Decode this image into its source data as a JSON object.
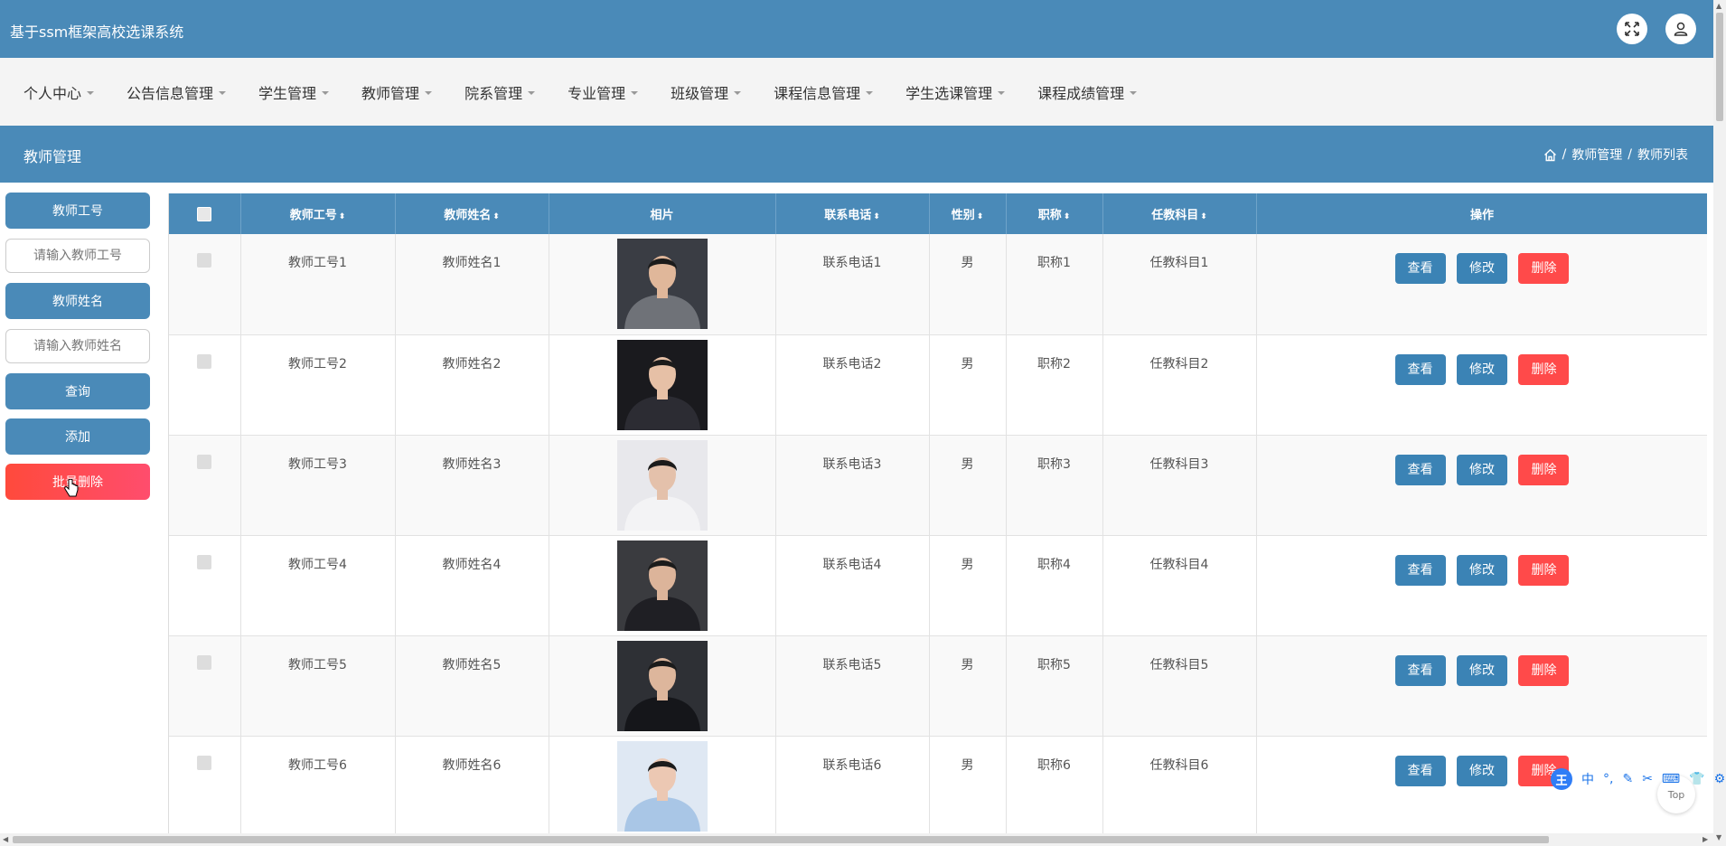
{
  "app": {
    "title": "基于ssm框架高校选课系统"
  },
  "header_icons": [
    "fullscreen-icon",
    "user-icon"
  ],
  "nav": {
    "items": [
      {
        "label": "个人中心"
      },
      {
        "label": "公告信息管理"
      },
      {
        "label": "学生管理"
      },
      {
        "label": "教师管理"
      },
      {
        "label": "院系管理"
      },
      {
        "label": "专业管理"
      },
      {
        "label": "班级管理"
      },
      {
        "label": "课程信息管理"
      },
      {
        "label": "学生选课管理"
      },
      {
        "label": "课程成绩管理"
      }
    ]
  },
  "page": {
    "title": "教师管理",
    "breadcrumb": {
      "sep1": "/",
      "level1": "教师管理",
      "sep2": "/",
      "level2": "教师列表"
    }
  },
  "sidebar": {
    "teacher_id_label": "教师工号",
    "teacher_id_placeholder": "请输入教师工号",
    "teacher_name_label": "教师姓名",
    "teacher_name_placeholder": "请输入教师姓名",
    "search_label": "查询",
    "add_label": "添加",
    "batch_delete_label": "批量删除"
  },
  "table": {
    "headers": {
      "teacher_id": "教师工号",
      "teacher_name": "教师姓名",
      "photo": "相片",
      "phone": "联系电话",
      "gender": "性别",
      "title": "职称",
      "subject": "任教科目",
      "actions": "操作"
    },
    "action_labels": {
      "view": "查看",
      "edit": "修改",
      "delete": "删除"
    },
    "rows": [
      {
        "teacher_id": "教师工号1",
        "teacher_name": "教师姓名1",
        "phone": "联系电话1",
        "gender": "男",
        "title": "职称1",
        "subject": "任教科目1"
      },
      {
        "teacher_id": "教师工号2",
        "teacher_name": "教师姓名2",
        "phone": "联系电话2",
        "gender": "男",
        "title": "职称2",
        "subject": "任教科目2"
      },
      {
        "teacher_id": "教师工号3",
        "teacher_name": "教师姓名3",
        "phone": "联系电话3",
        "gender": "男",
        "title": "职称3",
        "subject": "任教科目3"
      },
      {
        "teacher_id": "教师工号4",
        "teacher_name": "教师姓名4",
        "phone": "联系电话4",
        "gender": "男",
        "title": "职称4",
        "subject": "任教科目4"
      },
      {
        "teacher_id": "教师工号5",
        "teacher_name": "教师姓名5",
        "phone": "联系电话5",
        "gender": "男",
        "title": "职称5",
        "subject": "任教科目5"
      },
      {
        "teacher_id": "教师工号6",
        "teacher_name": "教师姓名6",
        "phone": "联系电话6",
        "gender": "男",
        "title": "职称6",
        "subject": "任教科目6"
      }
    ]
  },
  "overlay": {
    "top_label": "Top",
    "ime_badge": "王",
    "ime_lang": "中"
  },
  "colors": {
    "primary": "#4a8ab8",
    "action_blue": "#3b83b5",
    "danger": "#ff4a4a",
    "nav_bg": "#f4f4f4"
  }
}
